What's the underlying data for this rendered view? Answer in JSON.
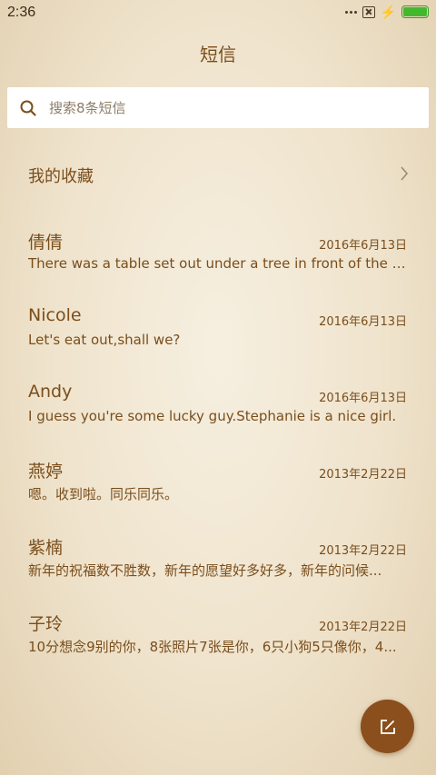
{
  "status_bar": {
    "time": "2:36",
    "battery_level": 1.0,
    "icons": [
      "signal-dots-icon",
      "no-sim-icon",
      "charging-bolt-icon",
      "battery-icon"
    ]
  },
  "header": {
    "title": "短信"
  },
  "search": {
    "placeholder": "搜索8条短信",
    "icon": "search-icon"
  },
  "favorites": {
    "label": "我的收藏",
    "icon": "chevron-right-icon"
  },
  "conversations": [
    {
      "name": "倩倩",
      "date": "2016年6月13日",
      "preview": "There was a table set out under a tree in front of the ho..."
    },
    {
      "name": "Nicole",
      "date": "2016年6月13日",
      "preview": "Let's eat out,shall we?"
    },
    {
      "name": "Andy",
      "date": "2016年6月13日",
      "preview": "I guess you're some lucky guy.Stephanie is a nice girl."
    },
    {
      "name": "燕婷",
      "date": "2013年2月22日",
      "preview": "嗯。收到啦。同乐同乐。"
    },
    {
      "name": "紫楠",
      "date": "2013年2月22日",
      "preview": "新年的祝福数不胜数，新年的愿望好多好多，新年的问候..."
    },
    {
      "name": "子玲",
      "date": "2013年2月22日",
      "preview": "10分想念9别的你，8张照片7张是你，6只小狗5只像你，4..."
    }
  ],
  "fab": {
    "icon": "compose-icon"
  },
  "colors": {
    "accent": "#8a4f1c",
    "text": "#7a4e1c",
    "battery": "#43b82d"
  }
}
